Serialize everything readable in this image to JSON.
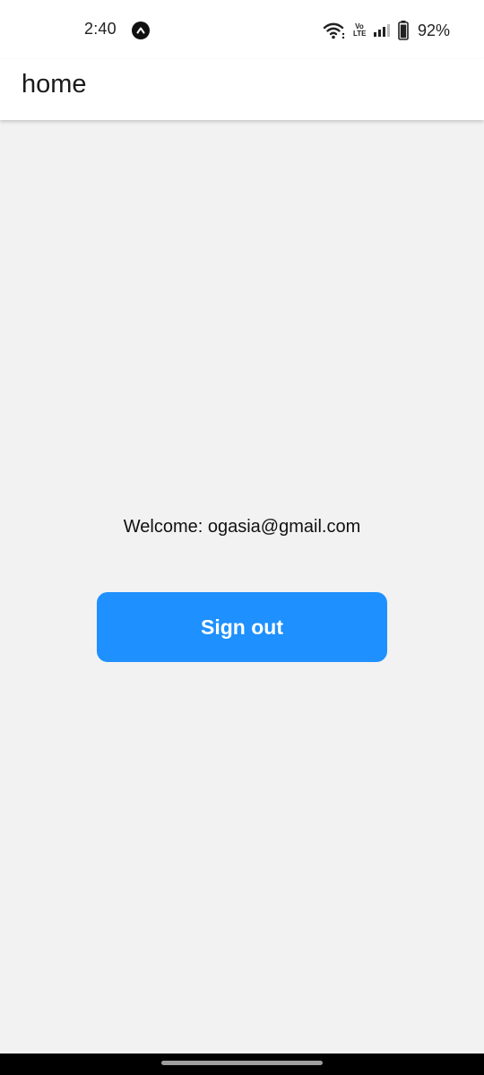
{
  "status_bar": {
    "time": "2:40",
    "badge_icon": "chevron-up-icon",
    "volte_label": "Vo\nLTE",
    "battery_percent": "92%"
  },
  "app_bar": {
    "title": "home"
  },
  "main": {
    "welcome_text": "Welcome: ogasia@gmail.com",
    "sign_out_label": "Sign out"
  },
  "colors": {
    "background": "#f2f2f2",
    "app_bar": "#ffffff",
    "button": "#1e90ff",
    "button_text": "#ffffff",
    "nav_bar": "#000000"
  }
}
